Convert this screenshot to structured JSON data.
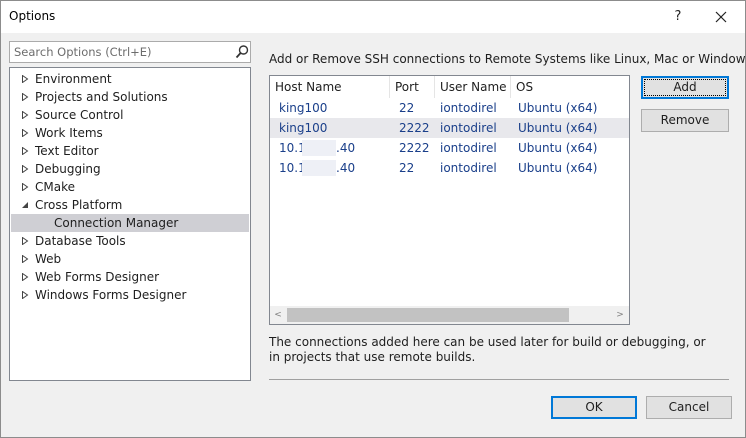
{
  "window": {
    "title": "Options",
    "help_glyph": "?"
  },
  "search": {
    "placeholder": "Search Options (Ctrl+E)",
    "value": ""
  },
  "tree": {
    "items": [
      {
        "label": "Environment",
        "expander": "collapsed",
        "level": 0
      },
      {
        "label": "Projects and Solutions",
        "expander": "collapsed",
        "level": 0
      },
      {
        "label": "Source Control",
        "expander": "collapsed",
        "level": 0
      },
      {
        "label": "Work Items",
        "expander": "collapsed",
        "level": 0
      },
      {
        "label": "Text Editor",
        "expander": "collapsed",
        "level": 0
      },
      {
        "label": "Debugging",
        "expander": "collapsed",
        "level": 0
      },
      {
        "label": "CMake",
        "expander": "collapsed",
        "level": 0
      },
      {
        "label": "Cross Platform",
        "expander": "expanded",
        "level": 0
      },
      {
        "label": "Connection Manager",
        "expander": "none",
        "level": 1,
        "selected": true
      },
      {
        "label": "Database Tools",
        "expander": "collapsed",
        "level": 0
      },
      {
        "label": "Web",
        "expander": "collapsed",
        "level": 0
      },
      {
        "label": "Web Forms Designer",
        "expander": "collapsed",
        "level": 0
      },
      {
        "label": "Windows Forms Designer",
        "expander": "collapsed",
        "level": 0
      }
    ]
  },
  "connections": {
    "heading": "Add or Remove SSH connections to Remote Systems like Linux, Mac or Windows:",
    "columns": [
      "Host Name",
      "Port",
      "User Name",
      "OS"
    ],
    "rows": [
      {
        "host": "king100",
        "host_suffix": "",
        "port": "22",
        "user": "iontodirel",
        "os": "Ubuntu (x64)",
        "selected": false
      },
      {
        "host": "king100",
        "host_suffix": "",
        "port": "2222",
        "user": "iontodirel",
        "os": "Ubuntu (x64)",
        "selected": true
      },
      {
        "host": "10.1",
        "host_suffix": ".40",
        "port": "2222",
        "user": "iontodirel",
        "os": "Ubuntu (x64)",
        "selected": false
      },
      {
        "host": "10.1",
        "host_suffix": ".40",
        "port": "22",
        "user": "iontodirel",
        "os": "Ubuntu (x64)",
        "selected": false
      }
    ],
    "scroll_left_glyph": "<",
    "scroll_right_glyph": ">",
    "note": "The connections added here can be used later for build or debugging, or in projects that use remote builds."
  },
  "buttons": {
    "add": "Add",
    "remove": "Remove",
    "ok": "OK",
    "cancel": "Cancel"
  },
  "colors": {
    "accent": "#0078d7",
    "tree_selection": "#cfcfd4",
    "row_selection": "#e8e8ec",
    "grid_text": "#1a3f8a"
  }
}
